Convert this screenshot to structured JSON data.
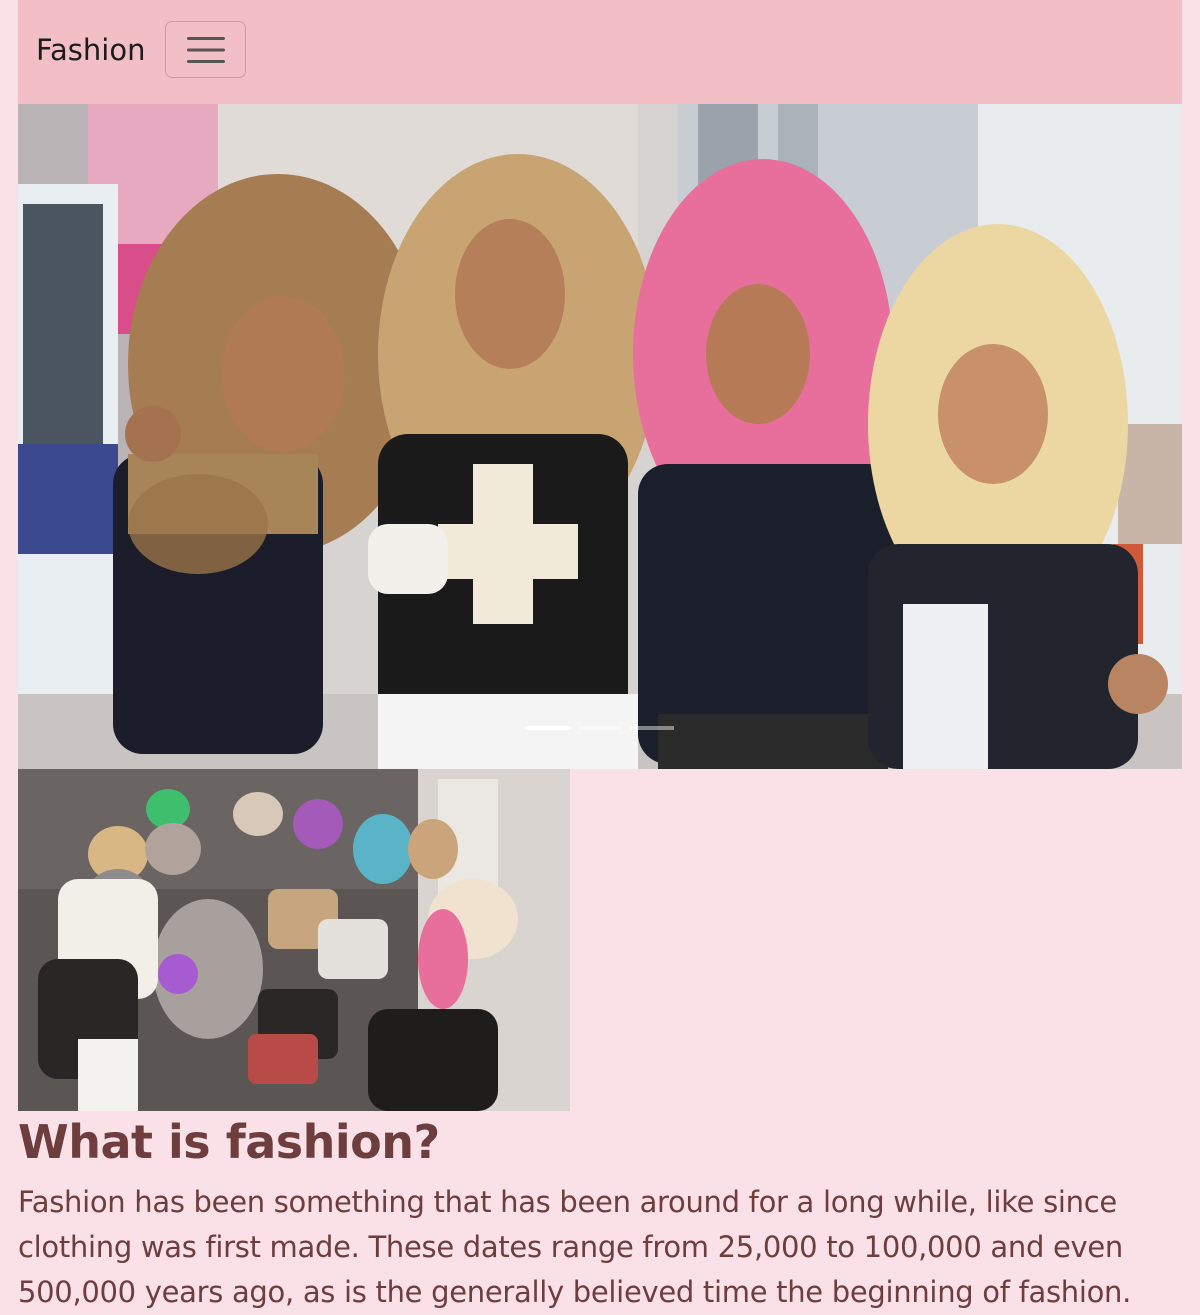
{
  "navbar": {
    "brand": "Fashion",
    "toggler_icon": "hamburger-menu-icon"
  },
  "carousel": {
    "slide_count": 3,
    "active_slide": 1,
    "image_alt": "four women with voluminous curly blonde and pink hair on a city street"
  },
  "gallery": {
    "image_alt": "group of women with colorful voluminous hair sitting on the pavement"
  },
  "article": {
    "heading": "What is fashion?",
    "body": "Fashion has been something that has been around for a long while, like since clothing was first made. These dates range from 25,000 to 100,000 and even 500,000 years ago, as is the generally believed time the beginning of fashion."
  },
  "colors": {
    "page_background": "#f9e1e7",
    "navbar_background": "#f2bfc6",
    "text_color": "#6e3d3d"
  }
}
